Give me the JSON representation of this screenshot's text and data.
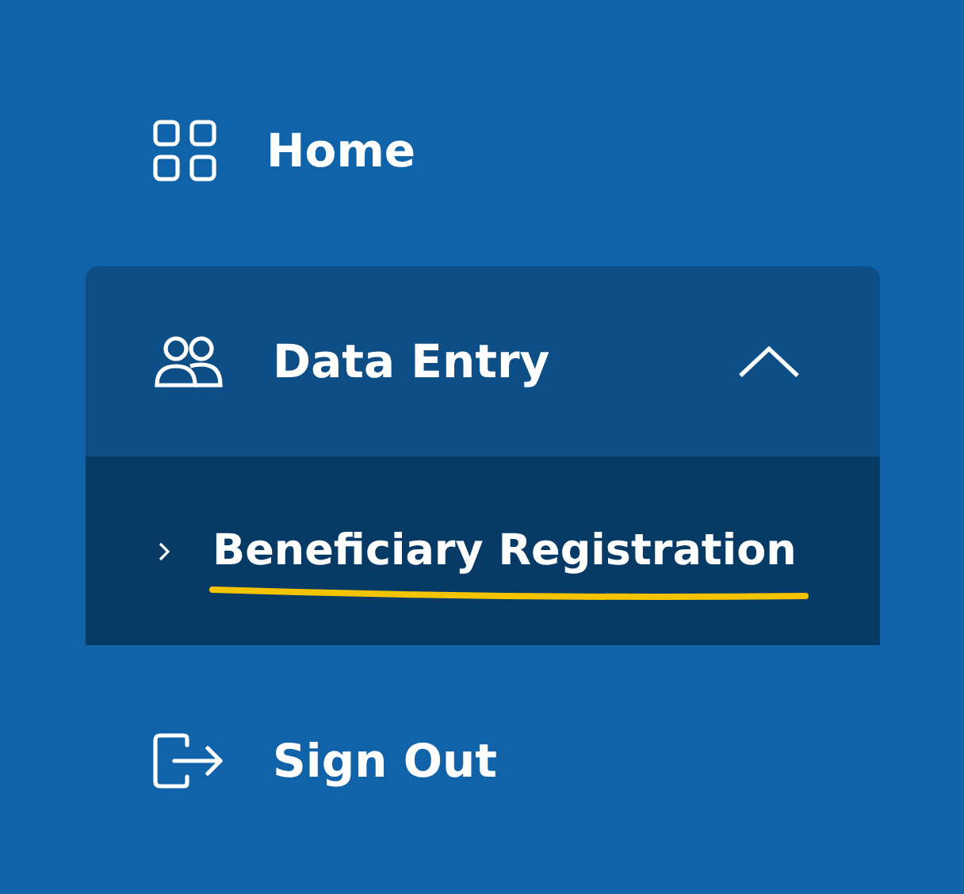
{
  "nav": [
    {
      "kind": "home",
      "label": "Home"
    },
    {
      "kind": "group",
      "label": "Data Entry",
      "expanded": true,
      "children": [
        {
          "label": "Beneficiary Registration",
          "selected": true
        }
      ]
    },
    {
      "kind": "signout",
      "label": "Sign Out"
    }
  ]
}
